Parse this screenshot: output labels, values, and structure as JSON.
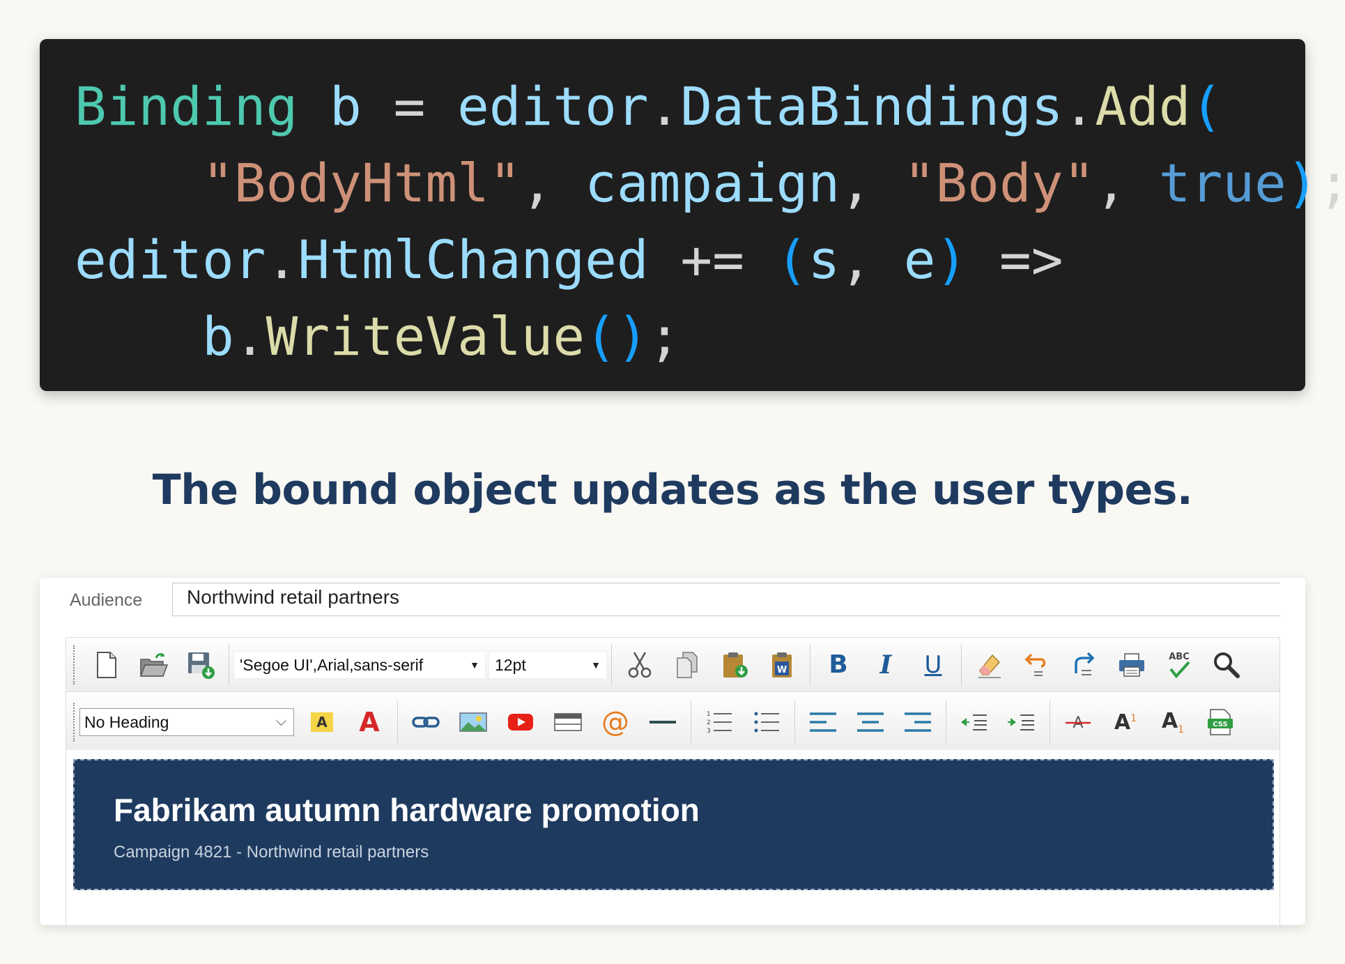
{
  "code": {
    "line1": {
      "t1": "Binding",
      "t2": " b ",
      "t3": "=",
      "t4": " editor",
      "t5": ".",
      "t6": "DataBindings",
      "t7": ".",
      "t8": "Add",
      "t9": "("
    },
    "line2": {
      "indent": "    ",
      "t1": "\"BodyHtml\"",
      "t2": ", ",
      "t3": "campaign",
      "t4": ", ",
      "t5": "\"Body\"",
      "t6": ", ",
      "t7": "true",
      "t8": ")",
      "t9": ";"
    },
    "line3": {
      "t1": "editor",
      "t2": ".",
      "t3": "HtmlChanged",
      "t4": " += ",
      "t5": "(",
      "t6": "s",
      "t7": ", ",
      "t8": "e",
      "t9": ")",
      "t10": " =>"
    },
    "line4": {
      "indent": "    ",
      "t1": "b",
      "t2": ".",
      "t3": "WriteValue",
      "t4": "(",
      "t5": ")",
      "t6": ";"
    }
  },
  "caption": "The bound object updates as the user types.",
  "audience": {
    "label": "Audience",
    "value": "Northwind retail partners"
  },
  "toolbar": {
    "font_family": "'Segoe UI',Arial,sans-serif",
    "font_size": "12pt",
    "heading": "No Heading",
    "icons_row1": [
      "new-document-icon",
      "open-folder-icon",
      "save-icon",
      "cut-icon",
      "copy-icon",
      "paste-icon",
      "paste-from-word-icon",
      "bold-icon",
      "italic-icon",
      "underline-icon",
      "eraser-icon",
      "undo-icon",
      "redo-icon",
      "print-icon",
      "spellcheck-icon",
      "find-icon"
    ],
    "icons_row2": [
      "highlight-color-icon",
      "font-color-icon",
      "link-icon",
      "image-icon",
      "video-icon",
      "table-icon",
      "email-icon",
      "horizontal-rule-icon",
      "ordered-list-icon",
      "unordered-list-icon",
      "align-left-icon",
      "align-center-icon",
      "align-right-icon",
      "outdent-icon",
      "indent-icon",
      "strikethrough-icon",
      "superscript-icon",
      "subscript-icon",
      "css-icon"
    ],
    "bold_glyph": "B",
    "italic_glyph": "I",
    "underline_glyph": "U",
    "highlight_glyph": "A",
    "fontcolor_glyph": "A",
    "email_glyph": "@",
    "spell_glyph": "ABC",
    "css_glyph": "CSS",
    "sup_glyph": "A",
    "sup_mark": "1",
    "sub_glyph": "A",
    "sub_mark": "1"
  },
  "content": {
    "title": "Fabrikam autumn hardware promotion",
    "subtitle": "Campaign 4821 - Northwind retail partners",
    "background": "#1e3a5f"
  },
  "colors": {
    "code_bg": "#1e1e1e",
    "caption": "#1f3a5f",
    "accent_blue": "#1f5c99"
  }
}
